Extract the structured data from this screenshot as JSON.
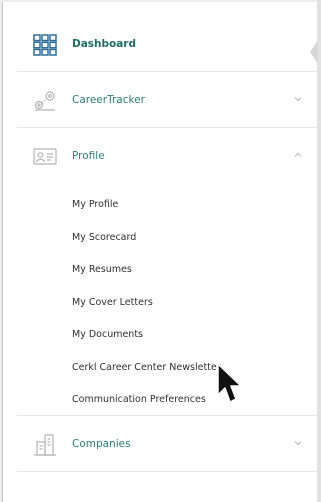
{
  "nav": {
    "dashboard": {
      "label": "Dashboard",
      "icon": "grid-icon"
    },
    "career_tracker": {
      "label": "CareerTracker",
      "icon": "map-route-icon"
    },
    "profile": {
      "label": "Profile",
      "icon": "id-card-icon",
      "items": [
        "My Profile",
        "My Scorecard",
        "My Resumes",
        "My Cover Letters",
        "My Documents",
        "Cerkl Career Center Newsletter",
        "Communication Preferences"
      ]
    },
    "companies": {
      "label": "Companies",
      "icon": "building-icon"
    }
  },
  "colors": {
    "accent": "#2d7d73",
    "text": "#303030",
    "divider": "#e6e6e6",
    "icon_gray": "#b3b3b3"
  }
}
